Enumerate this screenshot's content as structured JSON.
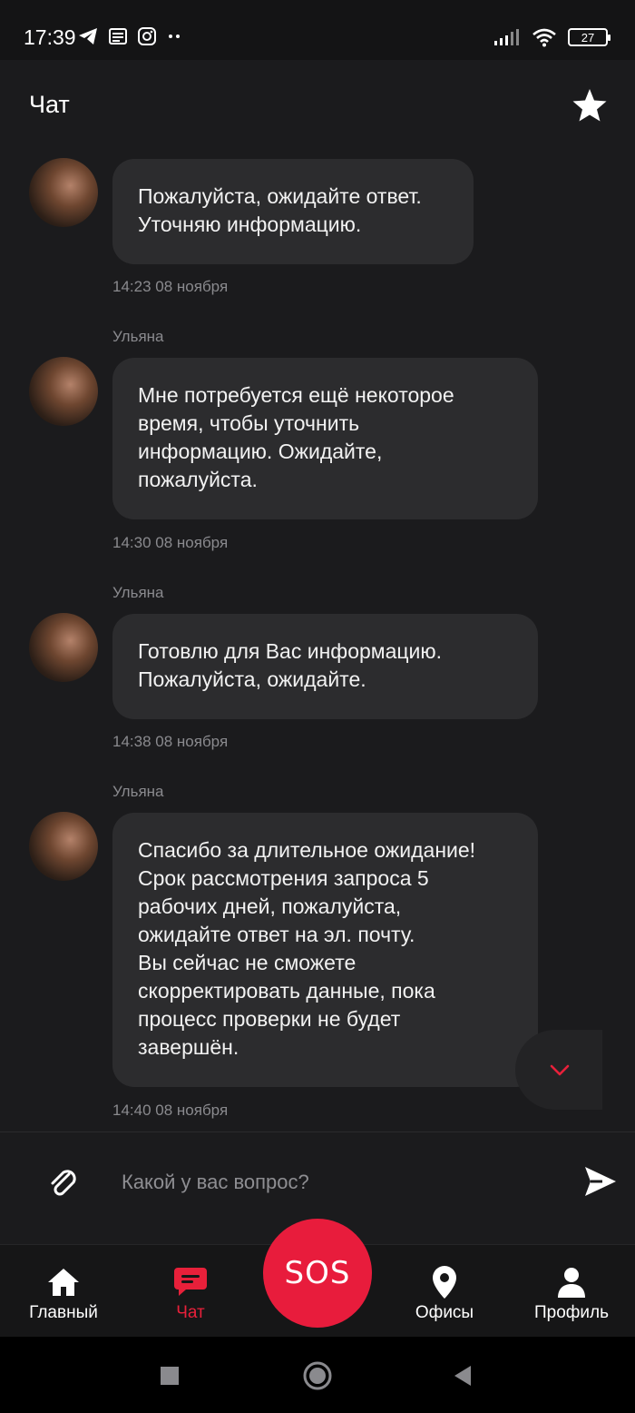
{
  "status_bar": {
    "time": "17:39",
    "battery": "27"
  },
  "header": {
    "title": "Чат"
  },
  "messages": [
    {
      "lines": [
        "Пожалуйста, ожидайте ответ.",
        "Уточняю информацию."
      ],
      "time": "14:23 08 ноября"
    },
    {
      "sender": "Ульяна",
      "lines": [
        "Мне потребуется ещё некоторое",
        "время, чтобы уточнить",
        "информацию. Ожидайте,",
        "пожалуйста."
      ],
      "time": "14:30 08 ноября"
    },
    {
      "sender": "Ульяна",
      "lines": [
        "Готовлю для Вас информацию.",
        "Пожалуйста, ожидайте."
      ],
      "time": "14:38 08 ноября"
    },
    {
      "sender": "Ульяна",
      "lines": [
        "Спасибо за длительное ожидание!",
        "Срок рассмотрения запроса 5",
        "рабочих дней, пожалуйста,",
        "ожидайте ответ на эл. почту.",
        "Вы сейчас не сможете",
        "скорректировать данные, пока",
        "процесс проверки не будет",
        "завершён."
      ],
      "time": "14:40 08 ноября"
    }
  ],
  "input": {
    "placeholder": "Какой у вас вопрос?"
  },
  "nav": {
    "home": "Главный",
    "chat": "Чат",
    "sos": "SOS",
    "offices": "Офисы",
    "profile": "Профиль"
  },
  "colors": {
    "accent": "#e81c3c",
    "bubble": "#2c2c2e",
    "background": "#1b1b1d"
  },
  "icons": [
    "telegram-icon",
    "news-icon",
    "instagram-icon",
    "signal-icon",
    "wifi-icon",
    "star-icon",
    "paperclip-icon",
    "send-icon",
    "chevron-down-icon",
    "home-icon",
    "chat-icon",
    "location-pin-icon",
    "person-icon"
  ]
}
